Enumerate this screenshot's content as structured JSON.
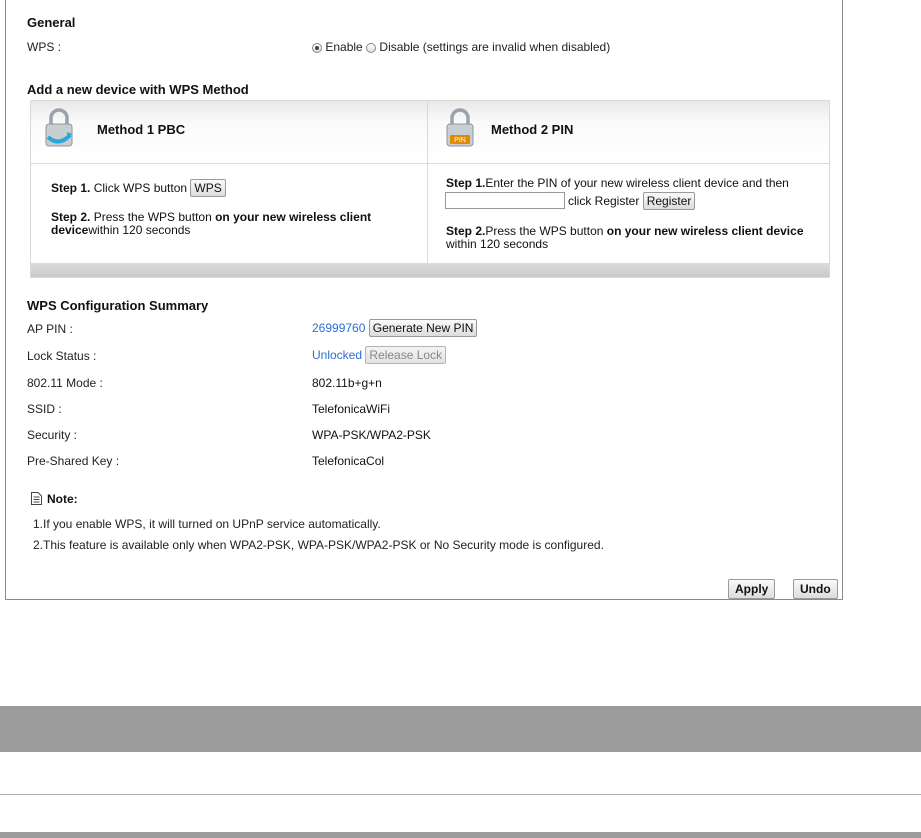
{
  "general": {
    "heading": "General",
    "wps_label": "WPS :",
    "enable_label": "Enable",
    "disable_label": "Disable (settings are invalid when disabled)",
    "selected": "Enable"
  },
  "add_device": {
    "heading": "Add a new device with WPS Method",
    "method1": {
      "title": "Method 1 PBC",
      "step1_bold": "Step 1.",
      "step1_text": " Click WPS button ",
      "wps_button": "WPS",
      "step2_bold": "Step 2.",
      "step2_text": " Press the WPS button ",
      "step2_bold2": "on your new wireless client device",
      "step2_tail": "within 120 seconds"
    },
    "method2": {
      "title": "Method 2 PIN",
      "pin_badge": "PIN",
      "step1_bold": "Step 1.",
      "step1_text": "Enter the PIN of your new wireless client device and then",
      "pin_value": "",
      "click_register": "click Register ",
      "register_button": "Register",
      "step2_bold": "Step 2.",
      "step2_text": "Press the WPS button ",
      "step2_bold2": "on your new wireless client device",
      "step2_tail": "within 120 seconds"
    }
  },
  "summary": {
    "heading": "WPS Configuration Summary",
    "ap_pin_label": "AP PIN :",
    "ap_pin_value": "26999760",
    "generate_button": "Generate New PIN",
    "lock_label": "Lock Status :",
    "lock_value": "Unlocked",
    "release_button": "Release Lock",
    "mode_label": "802.11 Mode :",
    "mode_value": "802.11b+g+n",
    "ssid_label": "SSID :",
    "ssid_value": "TelefonicaWiFi",
    "security_label": "Security :",
    "security_value": "WPA-PSK/WPA2-PSK",
    "psk_label": "Pre-Shared Key :",
    "psk_value": "TelefonicaCol"
  },
  "note": {
    "heading": "Note:",
    "line1": "1.If you enable WPS, it will turned on UPnP service automatically.",
    "line2": "2.This feature is available only when WPA2-PSK, WPA-PSK/WPA2-PSK or No Security mode is configured."
  },
  "actions": {
    "apply": "Apply",
    "undo": "Undo"
  },
  "colors": {
    "link": "#2a6fd6",
    "gray_bar": "#9c9c9c",
    "pin_badge": "#e08a00"
  },
  "icons": {
    "method1_icon": "padlock-refresh-icon",
    "method2_icon": "padlock-pin-icon",
    "note_icon": "document-icon"
  }
}
